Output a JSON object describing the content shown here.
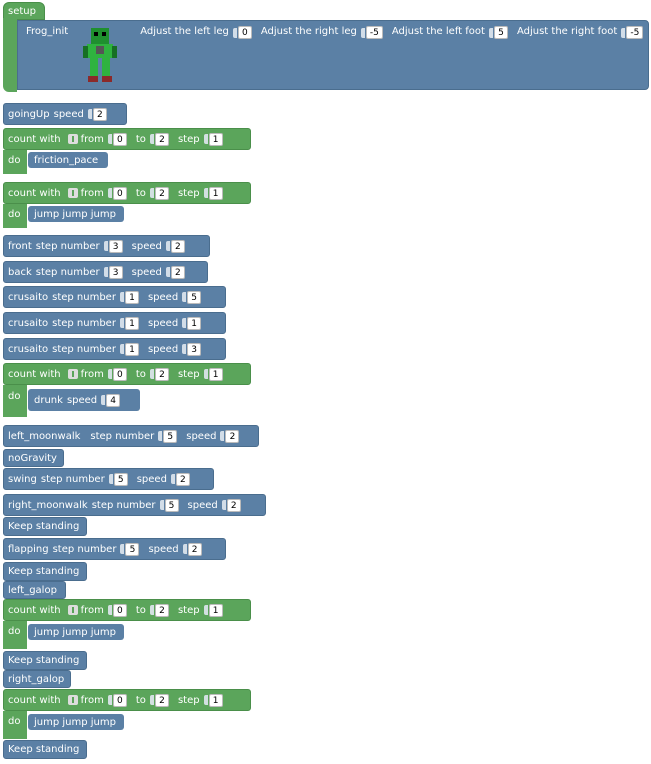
{
  "setup": {
    "label": "setup",
    "frog_init": "Frog_init",
    "adjust_left_leg": {
      "label": "Adjust the left leg",
      "value": "0"
    },
    "adjust_right_leg": {
      "label": "Adjust the right leg",
      "value": "-5"
    },
    "adjust_left_foot": {
      "label": "Adjust the left foot",
      "value": "5"
    },
    "adjust_right_foot": {
      "label": "Adjust the right foot",
      "value": "-5"
    }
  },
  "going_up": {
    "label": "goingUp",
    "speed_label": "speed",
    "speed": "2"
  },
  "loop_labels": {
    "count_with": "count with",
    "from": "from",
    "to": "to",
    "step": "step",
    "do": "do"
  },
  "loops": [
    {
      "from": "0",
      "to": "2",
      "step": "1",
      "body": "friction_pace"
    },
    {
      "from": "0",
      "to": "2",
      "step": "1",
      "body": "jump jump jump"
    },
    {
      "from": "0",
      "to": "2",
      "step": "1",
      "body": "drunk",
      "body_speed_label": "speed",
      "body_speed": "4"
    },
    {
      "from": "0",
      "to": "2",
      "step": "1",
      "body": "jump jump jump"
    },
    {
      "from": "0",
      "to": "2",
      "step": "1",
      "body": "jump jump jump"
    }
  ],
  "labels": {
    "step_number": "step number",
    "speed": "speed"
  },
  "moves": {
    "front": {
      "label": "front",
      "steps": "3",
      "speed": "2"
    },
    "back": {
      "label": "back",
      "steps": "3",
      "speed": "2"
    },
    "crusaito1": {
      "label": "crusaito",
      "steps": "1",
      "speed": "5"
    },
    "crusaito2": {
      "label": "crusaito",
      "steps": "1",
      "speed": "1"
    },
    "crusaito3": {
      "label": "crusaito",
      "steps": "1",
      "speed": "3"
    },
    "left_moonwalk": {
      "label": "left_moonwalk",
      "steps": "5",
      "speed": "2"
    },
    "no_gravity": {
      "label": "noGravity"
    },
    "swing": {
      "label": "swing",
      "steps": "5",
      "speed": "2"
    },
    "right_moonwalk": {
      "label": "right_moonwalk",
      "steps": "5",
      "speed": "2"
    },
    "keep_standing": "Keep standing",
    "flapping": {
      "label": "flapping",
      "steps": "5",
      "speed": "2"
    },
    "left_galop": {
      "label": "left_galop"
    },
    "right_galop": {
      "label": "right_galop"
    }
  },
  "colors": {
    "blue_block": "#5b80a5",
    "green_block": "#5ba55b"
  }
}
